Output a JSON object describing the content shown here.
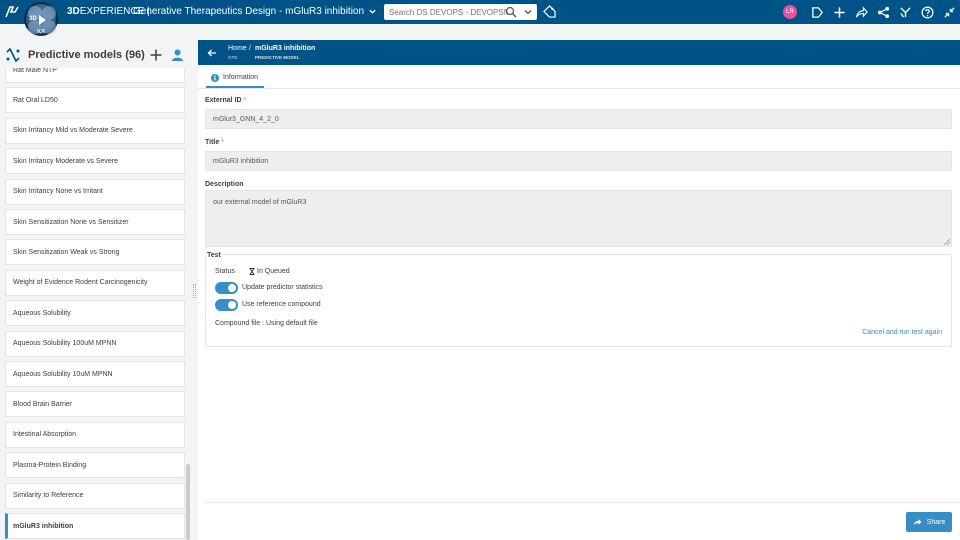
{
  "topbar": {
    "brand_bold": "3D",
    "brand_rest": "EXPERIENCE |",
    "compass_label": "3D",
    "compass_sub": "V,R",
    "app_title": "Generative Therapeutics Design - mGluR3 inhibition",
    "search_placeholder": "Search DS DEVOPS - DEVOPSMMO",
    "avatar_initials": "LR"
  },
  "left_panel": {
    "title": "Predictive models (96)",
    "items": [
      {
        "label": "Rat Male NTP",
        "selected": false
      },
      {
        "label": "Rat Oral LD50",
        "selected": false
      },
      {
        "label": "Skin Irritancy Mild vs Moderate Severe",
        "selected": false
      },
      {
        "label": "Skin Irritancy Moderate vs Severe",
        "selected": false
      },
      {
        "label": "Skin Irritancy None vs Irritant",
        "selected": false
      },
      {
        "label": "Skin Sensitization None vs Sensitizer",
        "selected": false
      },
      {
        "label": "Skin Sensitization Weak vs Strong",
        "selected": false
      },
      {
        "label": "Weight of Evidence Rodent Carcinogenicity",
        "selected": false
      },
      {
        "label": "Aqueous Solubility",
        "selected": false
      },
      {
        "label": "Aqueous Solubility 100uM MPNN",
        "selected": false
      },
      {
        "label": "Aqueous Solubility 10uM MPNN",
        "selected": false
      },
      {
        "label": "Blood Brain Barrier",
        "selected": false
      },
      {
        "label": "Intestinal Absorption",
        "selected": false
      },
      {
        "label": "Plasma-Protein Binding",
        "selected": false
      },
      {
        "label": "Similarity to Reference",
        "selected": false
      },
      {
        "label": "mGluR3 inhibition",
        "selected": true
      }
    ]
  },
  "right_panel": {
    "breadcrumb": {
      "home": "Home",
      "home_sub": "GTD",
      "separator": "/",
      "title": "mGluR3 inhibition",
      "type": "PREDICTIVE MODEL"
    },
    "tab_label": "Information",
    "external_id": {
      "label": "External ID",
      "required_mark": "*",
      "value": "mGlur3_GNN_4_2_0"
    },
    "title_field": {
      "label": "Title",
      "required_mark": "*",
      "value": "mGluR3 inhibition"
    },
    "description": {
      "label": "Description",
      "value": "our external model of mGluR3"
    },
    "test": {
      "title": "Test",
      "status_label": "Status",
      "status_icon": "hourglass-icon",
      "status_value": "In Queued",
      "toggle_1_label": "Update predictor statistics",
      "toggle_1_on": true,
      "toggle_2_label": "Use reference compound",
      "toggle_2_on": true,
      "compound_file": "Compound file : Using default file",
      "cancel_link": "Cancel and run test again"
    },
    "share_label": "Share"
  },
  "colors": {
    "header_blue": "#005386",
    "accent_blue": "#368ec4",
    "avatar_pink": "#e3529c",
    "required_orange": "#e87b00"
  }
}
